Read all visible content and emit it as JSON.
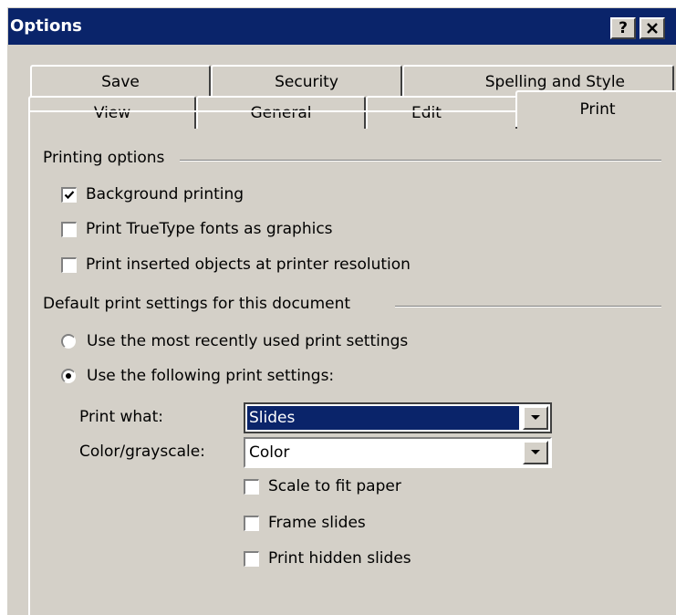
{
  "window": {
    "title": "Options",
    "help_button": "?",
    "close_button": "✕"
  },
  "tabs": {
    "back_row": [
      "Save",
      "Security",
      "Spelling and Style"
    ],
    "front_row": [
      "View",
      "General",
      "Edit",
      "Print"
    ],
    "active": "Print"
  },
  "printing_options": {
    "heading": "Printing options",
    "background_printing": {
      "label": "Background printing",
      "checked": true
    },
    "truetype_graphics": {
      "label": "Print TrueType fonts as graphics",
      "checked": false
    },
    "inserted_objects": {
      "label": "Print inserted objects at printer resolution",
      "checked": false
    }
  },
  "default_print": {
    "heading": "Default print settings for this document",
    "recent_radio": {
      "label": "Use the most recently used print settings",
      "selected": false
    },
    "following_radio": {
      "label": "Use the following print settings:",
      "selected": true
    },
    "print_what": {
      "label": "Print what:",
      "value": "Slides"
    },
    "color_grayscale": {
      "label": "Color/grayscale:",
      "value": "Color"
    },
    "scale_to_fit": {
      "label": "Scale to fit paper",
      "checked": false
    },
    "frame_slides": {
      "label": "Frame slides",
      "checked": false
    },
    "print_hidden": {
      "label": "Print hidden slides",
      "checked": false
    }
  },
  "colors": {
    "titlebar": "#0a246a",
    "face": "#d4d0c8",
    "selection": "#0a246a"
  }
}
